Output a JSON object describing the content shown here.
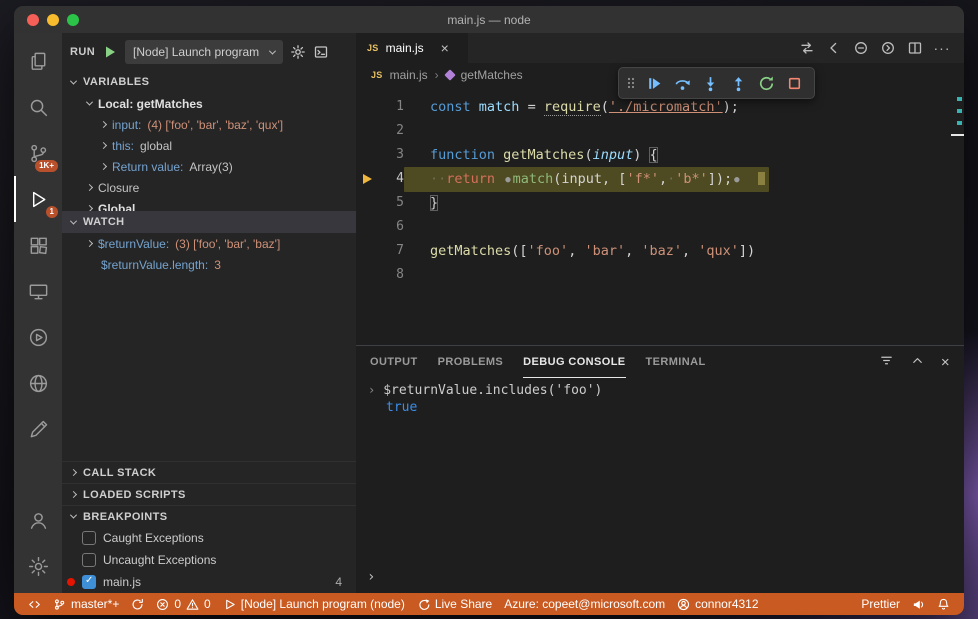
{
  "window_title": "main.js — node",
  "colors": {
    "status_bar_debugging": "#c85a22",
    "debug_line_highlight": "#4e4a21",
    "badge": "#b8502c",
    "breakpoint": "#e51400"
  },
  "activity_bar": {
    "scm_badge": "1K+",
    "debug_badge": "1"
  },
  "sidebar": {
    "toolbar": {
      "run_label": "RUN",
      "config": "[Node] Launch program"
    },
    "variables": {
      "header": "VARIABLES",
      "scope": "Local: getMatches",
      "items": [
        {
          "name": "input:",
          "value": "(4) ['foo', 'bar', 'baz', 'qux']"
        },
        {
          "name": "this:",
          "value": "global"
        },
        {
          "name": "Return value:",
          "value": "Array(3)"
        }
      ],
      "closure": "Closure",
      "global_scope": "Global"
    },
    "watch": {
      "header": "WATCH",
      "items": [
        {
          "name": "$returnValue:",
          "value": "(3) ['foo', 'bar', 'baz']"
        },
        {
          "name": "$returnValue.length:",
          "value": "3"
        }
      ]
    },
    "call_stack_header": "CALL STACK",
    "loaded_scripts_header": "LOADED SCRIPTS",
    "breakpoints": {
      "header": "BREAKPOINTS",
      "items": [
        {
          "label": "Caught Exceptions",
          "checked": false
        },
        {
          "label": "Uncaught Exceptions",
          "checked": false
        },
        {
          "label": "main.js",
          "checked": true,
          "count": "4"
        }
      ]
    }
  },
  "editor": {
    "tab": {
      "icon": "JS",
      "label": "main.js"
    },
    "breadcrumb": {
      "icon": "JS",
      "file": "main.js",
      "symbol": "getMatches"
    },
    "code": {
      "lines": [
        {
          "n": 1,
          "tokens": [
            {
              "t": "const ",
              "c": "kw"
            },
            {
              "t": "match ",
              "c": "vr"
            },
            {
              "t": "= ",
              "c": "pl"
            },
            {
              "t": "require",
              "c": "fn du"
            },
            {
              "t": "(",
              "c": "pl"
            },
            {
              "t": "'./micromatch'",
              "c": "str un"
            },
            {
              "t": ");",
              "c": "pl"
            }
          ]
        },
        {
          "n": 2,
          "tokens": []
        },
        {
          "n": 3,
          "tokens": [
            {
              "t": "function ",
              "c": "kw"
            },
            {
              "t": "getMatches",
              "c": "fn"
            },
            {
              "t": "(",
              "c": "pl"
            },
            {
              "t": "input",
              "c": "pr"
            },
            {
              "t": ") ",
              "c": "pl"
            },
            {
              "t": "{",
              "c": "pl bx"
            }
          ]
        },
        {
          "n": 4,
          "current": true,
          "tokens": [
            {
              "t": "··",
              "c": "ws"
            },
            {
              "t": "return",
              "c": "rt"
            },
            {
              "t": " ",
              "c": "pl"
            },
            {
              "t": "●",
              "c": "bpdot"
            },
            {
              "t": "match",
              "c": "mt"
            },
            {
              "t": "(",
              "c": "pl"
            },
            {
              "t": "input",
              "c": "pl"
            },
            {
              "t": ", ",
              "c": "pl"
            },
            {
              "t": "[",
              "c": "pl"
            },
            {
              "t": "'f*'",
              "c": "str"
            },
            {
              "t": ",",
              "c": "pl"
            },
            {
              "t": "·",
              "c": "ws"
            },
            {
              "t": "'b*'",
              "c": "str"
            },
            {
              "t": "]);",
              "c": "pl"
            },
            {
              "t": "●",
              "c": "bpdot"
            }
          ]
        },
        {
          "n": 5,
          "tokens": [
            {
              "t": "}",
              "c": "pl bx"
            }
          ]
        },
        {
          "n": 6,
          "tokens": []
        },
        {
          "n": 7,
          "tokens": [
            {
              "t": "getMatches",
              "c": "fn"
            },
            {
              "t": "([",
              "c": "pl"
            },
            {
              "t": "'foo'",
              "c": "str"
            },
            {
              "t": ", ",
              "c": "pl"
            },
            {
              "t": "'bar'",
              "c": "str"
            },
            {
              "t": ", ",
              "c": "pl"
            },
            {
              "t": "'baz'",
              "c": "str"
            },
            {
              "t": ", ",
              "c": "pl"
            },
            {
              "t": "'qux'",
              "c": "str"
            },
            {
              "t": "])",
              "c": "pl"
            }
          ]
        },
        {
          "n": 8,
          "tokens": []
        }
      ]
    }
  },
  "panel": {
    "tabs": [
      "OUTPUT",
      "PROBLEMS",
      "DEBUG CONSOLE",
      "TERMINAL"
    ],
    "active_tab": "DEBUG CONSOLE",
    "entries": [
      {
        "expression": "$returnValue.includes('foo')",
        "result": "true"
      }
    ],
    "prompt": "›"
  },
  "status_bar": {
    "branch": "master*+",
    "errors": "0",
    "warnings": "0",
    "launch_config": "[Node] Launch program (node)",
    "live_share": "Live Share",
    "azure_account": "Azure: copeet@microsoft.com",
    "github_account": "connor4312",
    "formatter": "Prettier"
  }
}
